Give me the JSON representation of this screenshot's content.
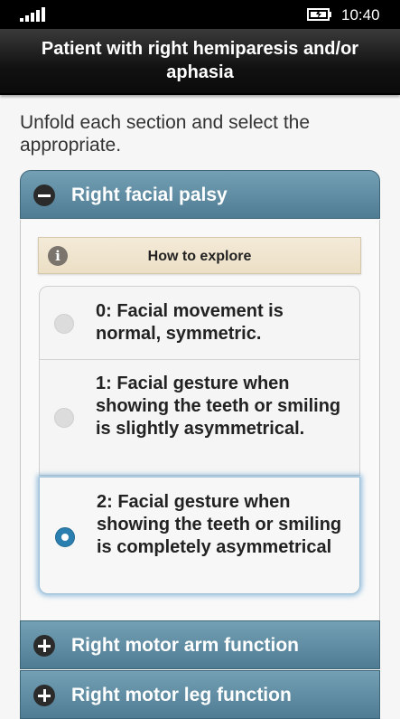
{
  "status_bar": {
    "time": "10:40",
    "signal_icon": "signal-bars-icon",
    "battery_icon": "battery-charging-icon"
  },
  "header": {
    "title": "Patient with right hemiparesis and/or aphasia"
  },
  "instructions": "Unfold each section and select the appropriate.",
  "sections": [
    {
      "label": "Right facial palsy",
      "expanded": true,
      "explore_label": "How to explore",
      "options": [
        {
          "text": "0: Facial movement is normal, symmetric.",
          "selected": false
        },
        {
          "text": "1: Facial gesture when showing the teeth or smiling is slightly asymmetrical.",
          "selected": false
        },
        {
          "text": "2: Facial gesture when showing the teeth or smiling is completely asymmetrical",
          "selected": true
        }
      ]
    },
    {
      "label": "Right motor arm function",
      "expanded": false
    },
    {
      "label": "Right motor leg function",
      "expanded": false
    }
  ],
  "colors": {
    "section_header": "#5f8ba1",
    "radio_selected": "#2b7fb0",
    "explore_bg": "#efe4cd"
  }
}
